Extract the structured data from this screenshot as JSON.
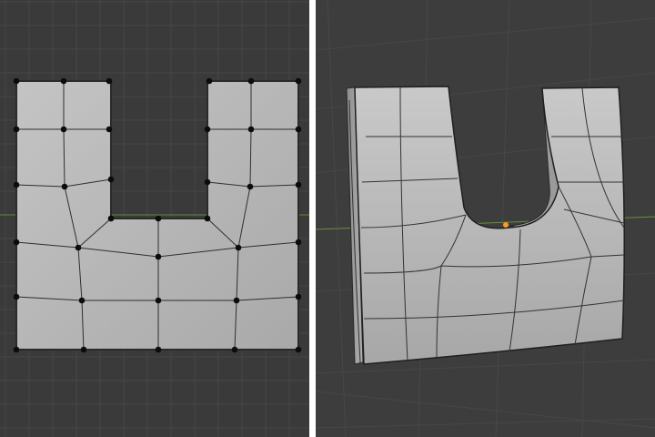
{
  "viewports": {
    "left": {
      "label": "",
      "background": "#3a3a3a",
      "grid_minor": "#444444",
      "grid_major": "#4c4c4c",
      "axis_y": "#5e8a3a"
    },
    "right": {
      "label": "",
      "background": "#3d3d3d",
      "grid_color": "#4a4a4a",
      "axis_x": "#6b8e3a",
      "origin": "#ff9a1f"
    }
  },
  "mesh": {
    "face_color": "#b5b5b5",
    "edge_color": "#3a3a3a",
    "vertex_color": "#0c0c0c",
    "shape": "U-shaped subdivided plane"
  },
  "divider": {
    "color": "#ffffff"
  }
}
